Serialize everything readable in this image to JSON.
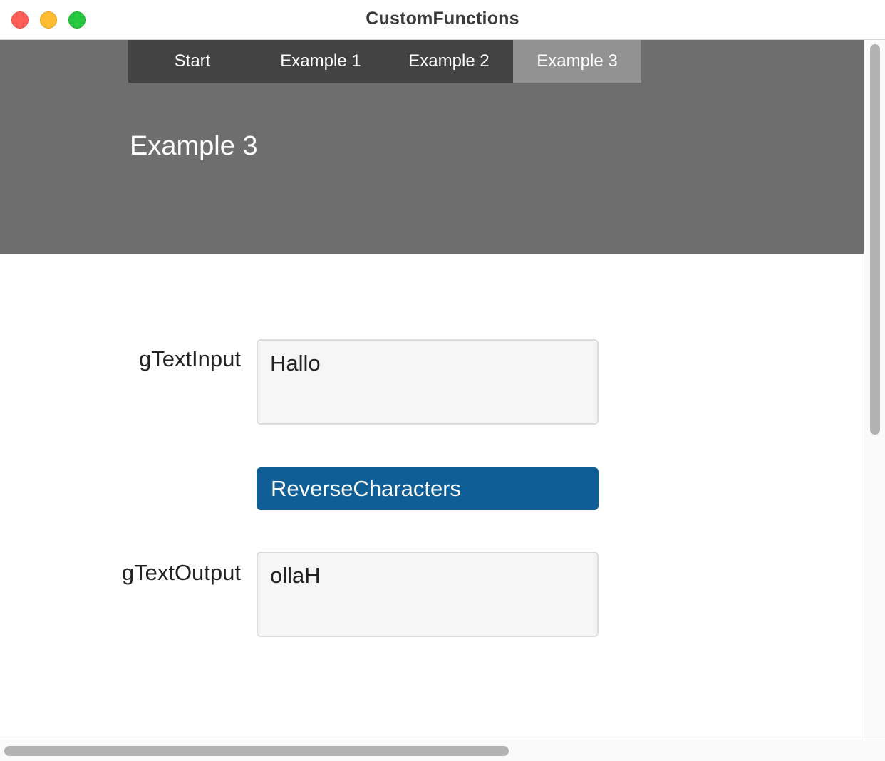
{
  "window": {
    "title": "CustomFunctions"
  },
  "nav": {
    "tabs": [
      {
        "label": "Start",
        "active": false
      },
      {
        "label": "Example 1",
        "active": false
      },
      {
        "label": "Example 2",
        "active": false
      },
      {
        "label": "Example 3",
        "active": true
      }
    ]
  },
  "hero": {
    "title": "Example 3"
  },
  "form": {
    "input_label": "gTextInput",
    "input_value": "Hallo",
    "button_label": "ReverseCharacters",
    "output_label": "gTextOutput",
    "output_value": "ollaH"
  },
  "colors": {
    "hero_background": "#6e6e6e",
    "navbar_background": "#434343",
    "active_tab": "#929292",
    "button_primary": "#0f5e95",
    "close_button": "#fe5f57",
    "minimize_button": "#febc2e",
    "maximize_button": "#28c840"
  }
}
